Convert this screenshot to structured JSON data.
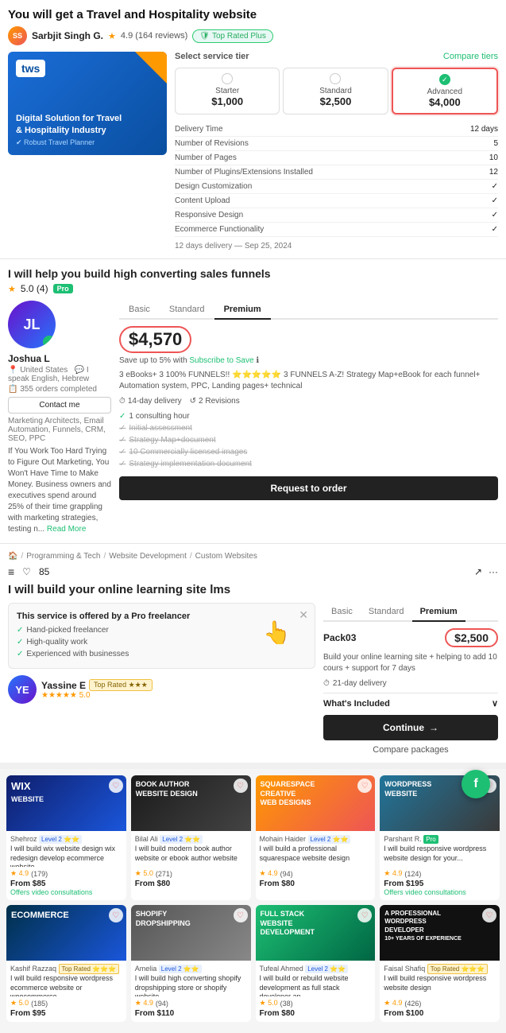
{
  "section1": {
    "title": "You will get a Travel and Hospitality website",
    "seller": {
      "name": "Sarbjit Singh G.",
      "initials": "SS",
      "rating": "4.9",
      "reviews": "164 reviews",
      "top_rated": "Top Rated Plus"
    },
    "hero": {
      "logo": "tws",
      "headline": "Digital Solution for Travel",
      "subheadline": "& Hospitality Industry",
      "subtitle": "✔ Robust Travel Planner"
    },
    "service_tier": {
      "label": "Select service tier",
      "compare": "Compare tiers",
      "tiers": [
        {
          "name": "Starter",
          "price": "$1,000",
          "selected": false
        },
        {
          "name": "Standard",
          "price": "$2,500",
          "selected": false
        },
        {
          "name": "Advanced",
          "price": "$4,000",
          "selected": true
        }
      ],
      "details": [
        {
          "label": "Delivery Time",
          "value": "12 days"
        },
        {
          "label": "Number of Revisions",
          "value": "5"
        },
        {
          "label": "Number of Pages",
          "value": "10"
        },
        {
          "label": "Number of Plugins/Extensions Installed",
          "value": "12"
        },
        {
          "label": "Design Customization",
          "value": "✓"
        },
        {
          "label": "Content Upload",
          "value": "✓"
        },
        {
          "label": "Responsive Design",
          "value": "✓"
        },
        {
          "label": "Ecommerce Functionality",
          "value": "✓"
        }
      ],
      "footer": "12 days delivery — Sep 25, 2024"
    }
  },
  "section2": {
    "title": "I will help you build high converting sales funnels",
    "rating": "5.0",
    "reviews": "4",
    "pro": "Pro",
    "seller": {
      "name": "Joshua L",
      "initials": "JL",
      "location": "United States",
      "languages": "I speak English, Hebrew",
      "orders": "355 orders completed",
      "contact": "Contact me",
      "tags": "Marketing Architects, Email Automation, Funnels, CRM, SEO, PPC",
      "desc": "If You Work Too Hard Trying to Figure Out Marketing, You Won't Have Time to Make Money. Business owners and executives spend around 25% of their time grappling with marketing strategies, testing n...",
      "read_more": "Read More"
    },
    "tabs": [
      "Basic",
      "Standard",
      "Premium"
    ],
    "active_tab": "Premium",
    "price": "$4,570",
    "price_note": "Save up to 5% with Subscribe to Save",
    "package_desc": "3 eBooks+ 3 100% FUNNELS!! ⭐⭐⭐⭐⭐ 3 FUNNELS A-Z! Strategy Map+eBook for each funnel+ Automation system, PPC, Landing pages+ technical",
    "delivery": "14-day delivery",
    "revisions": "2 Revisions",
    "features": [
      {
        "text": "1 consulting hour",
        "active": true
      },
      {
        "text": "Initial assessment",
        "active": false
      },
      {
        "text": "Strategy Map+document",
        "active": false
      },
      {
        "text": "10 Commercially licensed images",
        "active": false
      },
      {
        "text": "Strategy implementation document",
        "active": false
      }
    ],
    "cta": "Request to order"
  },
  "section3": {
    "breadcrumb": [
      "Programming & Tech",
      "Website Development",
      "Custom Websites"
    ],
    "icons": [
      "≡",
      "♡",
      "85",
      "↗",
      "···"
    ],
    "title": "I will build your online learning site lms",
    "pro_notice": {
      "title": "This service is offered by a Pro freelancer",
      "items": [
        "Hand-picked freelancer",
        "High-quality work",
        "Experienced with businesses"
      ]
    },
    "seller": {
      "name": "Yassine E",
      "initials": "YE",
      "top_rated": "Top Rated",
      "stars": "★★★",
      "rating": "5.0"
    },
    "tabs": [
      "Basic",
      "Standard",
      "Premium"
    ],
    "active_tab": "Premium",
    "package_name": "Pack03",
    "price": "$2,500",
    "desc": "Build your online learning site + helping to add 10 cours + support for 7 days",
    "delivery": "21-day delivery",
    "whats_included": "What's Included",
    "cta": "Continue",
    "compare": "Compare packages"
  },
  "grid": {
    "rows": [
      [
        {
          "seller": "Shehroz",
          "level": "Level 2 ⭐⭐",
          "title": "I will build wix website design wix redesign develop ecommerce website...",
          "rating": "4.9",
          "reviews": "(179)",
          "price": "From $85",
          "offer": "Offers video consultations",
          "thumb_class": "thumb-wix",
          "thumb_label": "WIX WEBSITE",
          "pro": false
        },
        {
          "seller": "Bilal Ali",
          "level": "Level 2 ⭐⭐",
          "title": "I will build modern book author website or ebook author website",
          "rating": "5.0",
          "reviews": "(271)",
          "price": "From $80",
          "offer": "",
          "thumb_class": "thumb-book",
          "thumb_label": "BOOK AUTHOR WEBSITE DESIGN",
          "pro": false
        },
        {
          "seller": "Mohain Haider",
          "level": "Level 2 ⭐⭐",
          "title": "I will build a professional squarespace website design",
          "rating": "4.9",
          "reviews": "(94)",
          "price": "From $80",
          "offer": "",
          "thumb_class": "thumb-sq",
          "thumb_label": "SQUARESPACE CREATIVE WEB DESIGNS",
          "pro": false
        },
        {
          "seller": "Parshant R.",
          "level": "",
          "title": "I will build responsive wordpress website design for your...",
          "rating": "4.9",
          "reviews": "(124)",
          "price": "From $195",
          "offer": "Offers video consultations",
          "thumb_class": "thumb-wp",
          "thumb_label": "WORDPRESS WEBSITE",
          "pro": true
        }
      ],
      [
        {
          "seller": "Kashif Razzaq",
          "level": "",
          "title": "I will build responsive wordpress ecommerce website or woocommerce...",
          "rating": "5.0",
          "reviews": "(185)",
          "price": "From $95",
          "offer": "",
          "thumb_class": "thumb-ecom",
          "thumb_label": "ECOMMERCE",
          "pro": false,
          "top_rated": "Top Rated ⭐⭐⭐"
        },
        {
          "seller": "Amelia",
          "level": "Level 2 ⭐⭐",
          "title": "I will build high converting shopify dropshipping store or shopify website",
          "rating": "4.9",
          "reviews": "(94)",
          "price": "From $110",
          "offer": "",
          "thumb_class": "thumb-drop",
          "thumb_label": "DROPSHIPPING",
          "pro": false
        },
        {
          "seller": "Tufeal Ahmed",
          "level": "Level 2 ⭐⭐",
          "title": "I will build or rebuild website development as full stack developer an...",
          "rating": "5.0",
          "reviews": "(38)",
          "price": "From $80",
          "offer": "",
          "thumb_class": "thumb-fullstack",
          "thumb_label": "FULL STACK WEBSITE DEVELOPMENT",
          "pro": false
        },
        {
          "seller": "Faisal Shafiq",
          "level": "",
          "title": "I will build responsive wordpress website design",
          "rating": "4.9",
          "reviews": "(426)",
          "price": "From $100",
          "offer": "",
          "thumb_class": "thumb-wpdev",
          "thumb_label": "A PROFESSIONAL WORDPRESS DEVELOPER",
          "pro": false,
          "top_rated": "Top Rated ⭐⭐⭐"
        }
      ]
    ]
  },
  "fab": {
    "label": "f"
  }
}
